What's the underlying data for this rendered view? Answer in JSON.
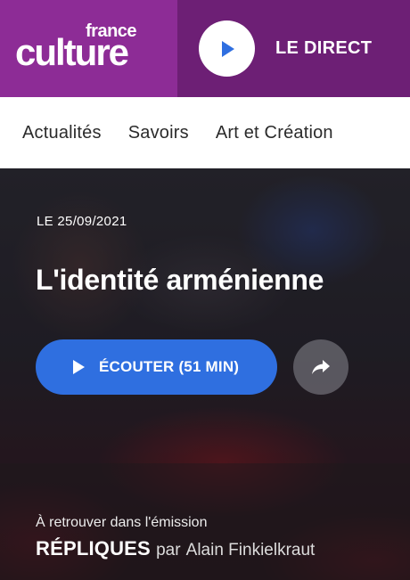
{
  "brand": {
    "small": "france",
    "large": "culture"
  },
  "direct": {
    "label": "LE DIRECT"
  },
  "nav": {
    "items": [
      "Actualités",
      "Savoirs",
      "Art et Création"
    ]
  },
  "episode": {
    "date": "LE 25/09/2021",
    "title": "L'identité arménienne",
    "listen_label": "ÉCOUTER (51 MIN)"
  },
  "emission": {
    "intro": "À retrouver dans l'émission",
    "name": "RÉPLIQUES",
    "by": "par",
    "author": "Alain Finkielkraut"
  },
  "colors": {
    "brand": "#8d2c96",
    "brand_dark": "#6d1f75",
    "accent": "#2f6fe0"
  },
  "icons": {
    "play": "play-icon",
    "share": "share-icon"
  }
}
